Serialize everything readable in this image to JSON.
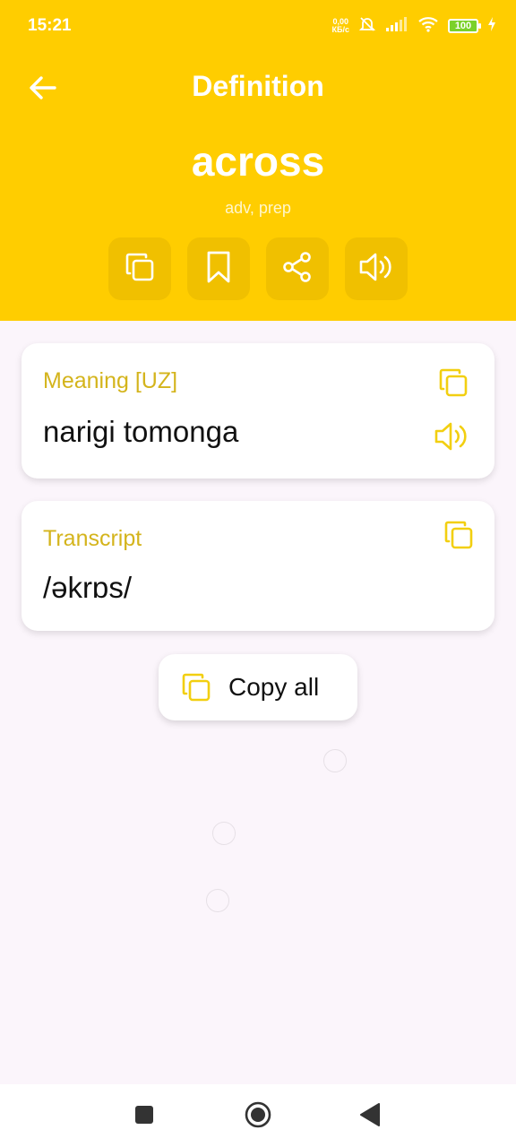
{
  "status_bar": {
    "time": "15:21",
    "net_speed_value": "0,00",
    "net_speed_unit": "КБ/с",
    "battery": "100"
  },
  "header": {
    "title": "Definition",
    "word": "across",
    "part_of_speech": "adv, prep",
    "actions": [
      "copy-icon",
      "bookmark-icon",
      "share-icon",
      "speaker-icon"
    ]
  },
  "meaning_card": {
    "label": "Meaning [UZ]",
    "value": "narigi tomonga"
  },
  "transcript_card": {
    "label": "Transcript",
    "value": "/əkrɒs/"
  },
  "copy_all": {
    "label": "Copy all"
  },
  "colors": {
    "brand_yellow": "#ffcd00",
    "accent_text": "#d4b41c",
    "icon_yellow": "#f2cf10",
    "background": "#fbf5fb"
  }
}
